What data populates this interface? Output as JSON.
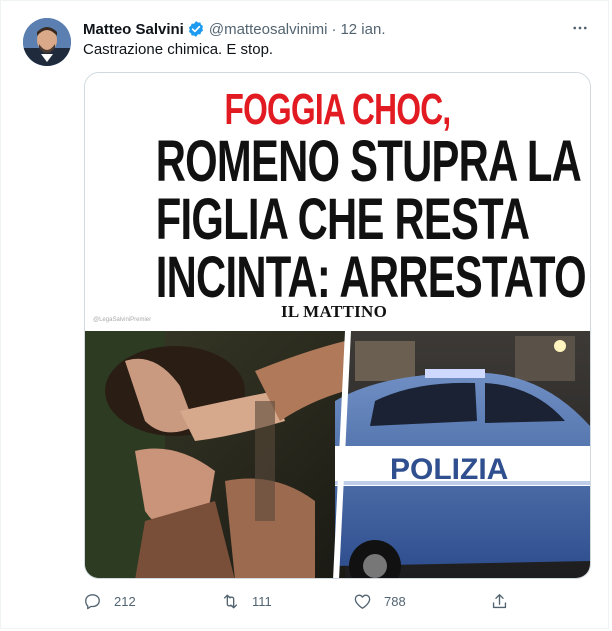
{
  "author": {
    "name": "Matteo Salvini",
    "handle": "@matteosalvinimi",
    "separator": "·",
    "date": "12 ian."
  },
  "tweet": {
    "text": "Castrazione chimica. E stop."
  },
  "media": {
    "kicker": "FOGGIA CHOC,",
    "headline_lines": [
      "ROMENO STUPRA LA",
      "FIGLIA CHE RESTA",
      "INCINTA: ARRESTATO"
    ],
    "logo": "IL MATTINO",
    "watermark": "@LegaSalviniPremier",
    "police_text": "POLIZIA"
  },
  "actions": {
    "replies": "212",
    "retweets": "111",
    "likes": "788"
  },
  "icons": {
    "verified": "verified-badge-icon",
    "more": "more-dots-icon",
    "reply": "reply-icon",
    "retweet": "retweet-icon",
    "like": "heart-icon",
    "share": "share-icon"
  },
  "colors": {
    "verified": "#1d9bf0",
    "kicker": "#e21b22",
    "muted": "#536471"
  }
}
